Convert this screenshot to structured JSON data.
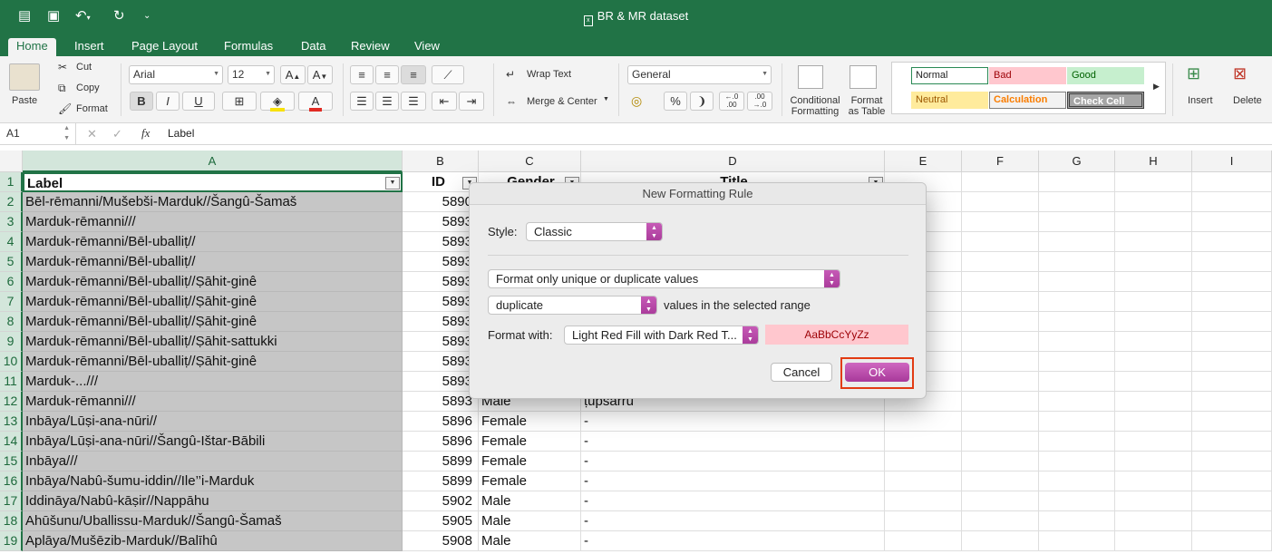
{
  "titlebar": {
    "doc_title": "BR & MR dataset"
  },
  "tabs": [
    "Home",
    "Insert",
    "Page Layout",
    "Formulas",
    "Data",
    "Review",
    "View"
  ],
  "ribbon": {
    "paste": "Paste",
    "cut": "Cut",
    "copy": "Copy",
    "format": "Format",
    "font_name": "Arial",
    "font_size": "12",
    "bold": "B",
    "italic": "I",
    "underline": "U",
    "wrap_text": "Wrap Text",
    "merge_center": "Merge & Center",
    "number_format": "General",
    "conditional_formatting_1": "Conditional",
    "conditional_formatting_2": "Formatting",
    "format_table_1": "Format",
    "format_table_2": "as Table",
    "styles": {
      "normal": "Normal",
      "bad": "Bad",
      "good": "Good",
      "neutral": "Neutral",
      "calculation": "Calculation",
      "check_cell": "Check Cell"
    },
    "insert": "Insert",
    "delete": "Delete"
  },
  "formula_bar": {
    "name_box": "A1",
    "fx": "fx",
    "value": "Label"
  },
  "columns": [
    "A",
    "B",
    "C",
    "D",
    "E",
    "F",
    "G",
    "H",
    "I"
  ],
  "header_row": {
    "label": "Label",
    "id": "ID",
    "gender": "Gender",
    "title": "Title"
  },
  "rows": [
    {
      "n": "2",
      "label": "Bēl-rēmanni/Mušebši-Marduk//Šangû-Šamaš",
      "id": "5890",
      "gender": "",
      "title": ""
    },
    {
      "n": "3",
      "label": "Marduk-rēmanni///",
      "id": "5893",
      "gender": "",
      "title": ""
    },
    {
      "n": "4",
      "label": "Marduk-rēmanni/Bēl-uballiṭ//",
      "id": "5893",
      "gender": "",
      "title": ""
    },
    {
      "n": "5",
      "label": "Marduk-rēmanni/Bēl-uballiṭ//",
      "id": "5893",
      "gender": "",
      "title": ""
    },
    {
      "n": "6",
      "label": "Marduk-rēmanni/Bēl-uballiṭ//Ṣāhit-ginê",
      "id": "5893",
      "gender": "",
      "title": ""
    },
    {
      "n": "7",
      "label": "Marduk-rēmanni/Bēl-uballiṭ//Ṣāhit-ginê",
      "id": "5893",
      "gender": "",
      "title": ""
    },
    {
      "n": "8",
      "label": "Marduk-rēmanni/Bēl-uballiṭ//Ṣāhit-ginê",
      "id": "5893",
      "gender": "",
      "title": ""
    },
    {
      "n": "9",
      "label": "Marduk-rēmanni/Bēl-uballiṭ//Ṣāhit-sattukki",
      "id": "5893",
      "gender": "",
      "title": ""
    },
    {
      "n": "10",
      "label": "Marduk-rēmanni/Bēl-uballiṭ//Ṣāhit-ginê",
      "id": "5893",
      "gender": "",
      "title": ""
    },
    {
      "n": "11",
      "label": "Marduk-...///",
      "id": "5893",
      "gender": "",
      "title": ""
    },
    {
      "n": "12",
      "label": "Marduk-rēmanni///",
      "id": "5893",
      "gender": "Male",
      "title": "ṭupsarru"
    },
    {
      "n": "13",
      "label": "Inbāya/Lūṣi-ana-nūri//",
      "id": "5896",
      "gender": "Female",
      "title": "-"
    },
    {
      "n": "14",
      "label": "Inbāya/Lūṣi-ana-nūri//Šangû-Ištar-Bābili",
      "id": "5896",
      "gender": "Female",
      "title": "-"
    },
    {
      "n": "15",
      "label": "Inbāya///",
      "id": "5899",
      "gender": "Female",
      "title": "-"
    },
    {
      "n": "16",
      "label": "Inbāya/Nabû-šumu-iddin//Ile’’i-Marduk",
      "id": "5899",
      "gender": "Female",
      "title": "-"
    },
    {
      "n": "17",
      "label": "Iddināya/Nabû-kāṣir//Nappāhu",
      "id": "5902",
      "gender": "Male",
      "title": "-"
    },
    {
      "n": "18",
      "label": "Ahūšunu/Uballissu-Marduk//Šangû-Šamaš",
      "id": "5905",
      "gender": "Male",
      "title": "-"
    },
    {
      "n": "19",
      "label": "Aplāya/Mušēzib-Marduk//Balīhû",
      "id": "5908",
      "gender": "Male",
      "title": "-"
    }
  ],
  "dialog": {
    "title": "New Formatting Rule",
    "style_label": "Style:",
    "style_value": "Classic",
    "rule_type": "Format only unique or duplicate values",
    "dup_value": "duplicate",
    "dup_suffix": "values in the selected range",
    "format_with_label": "Format with:",
    "format_with_value": "Light Red Fill with Dark Red T...",
    "preview": "AaBbCcYyZz",
    "cancel": "Cancel",
    "ok": "OK"
  }
}
